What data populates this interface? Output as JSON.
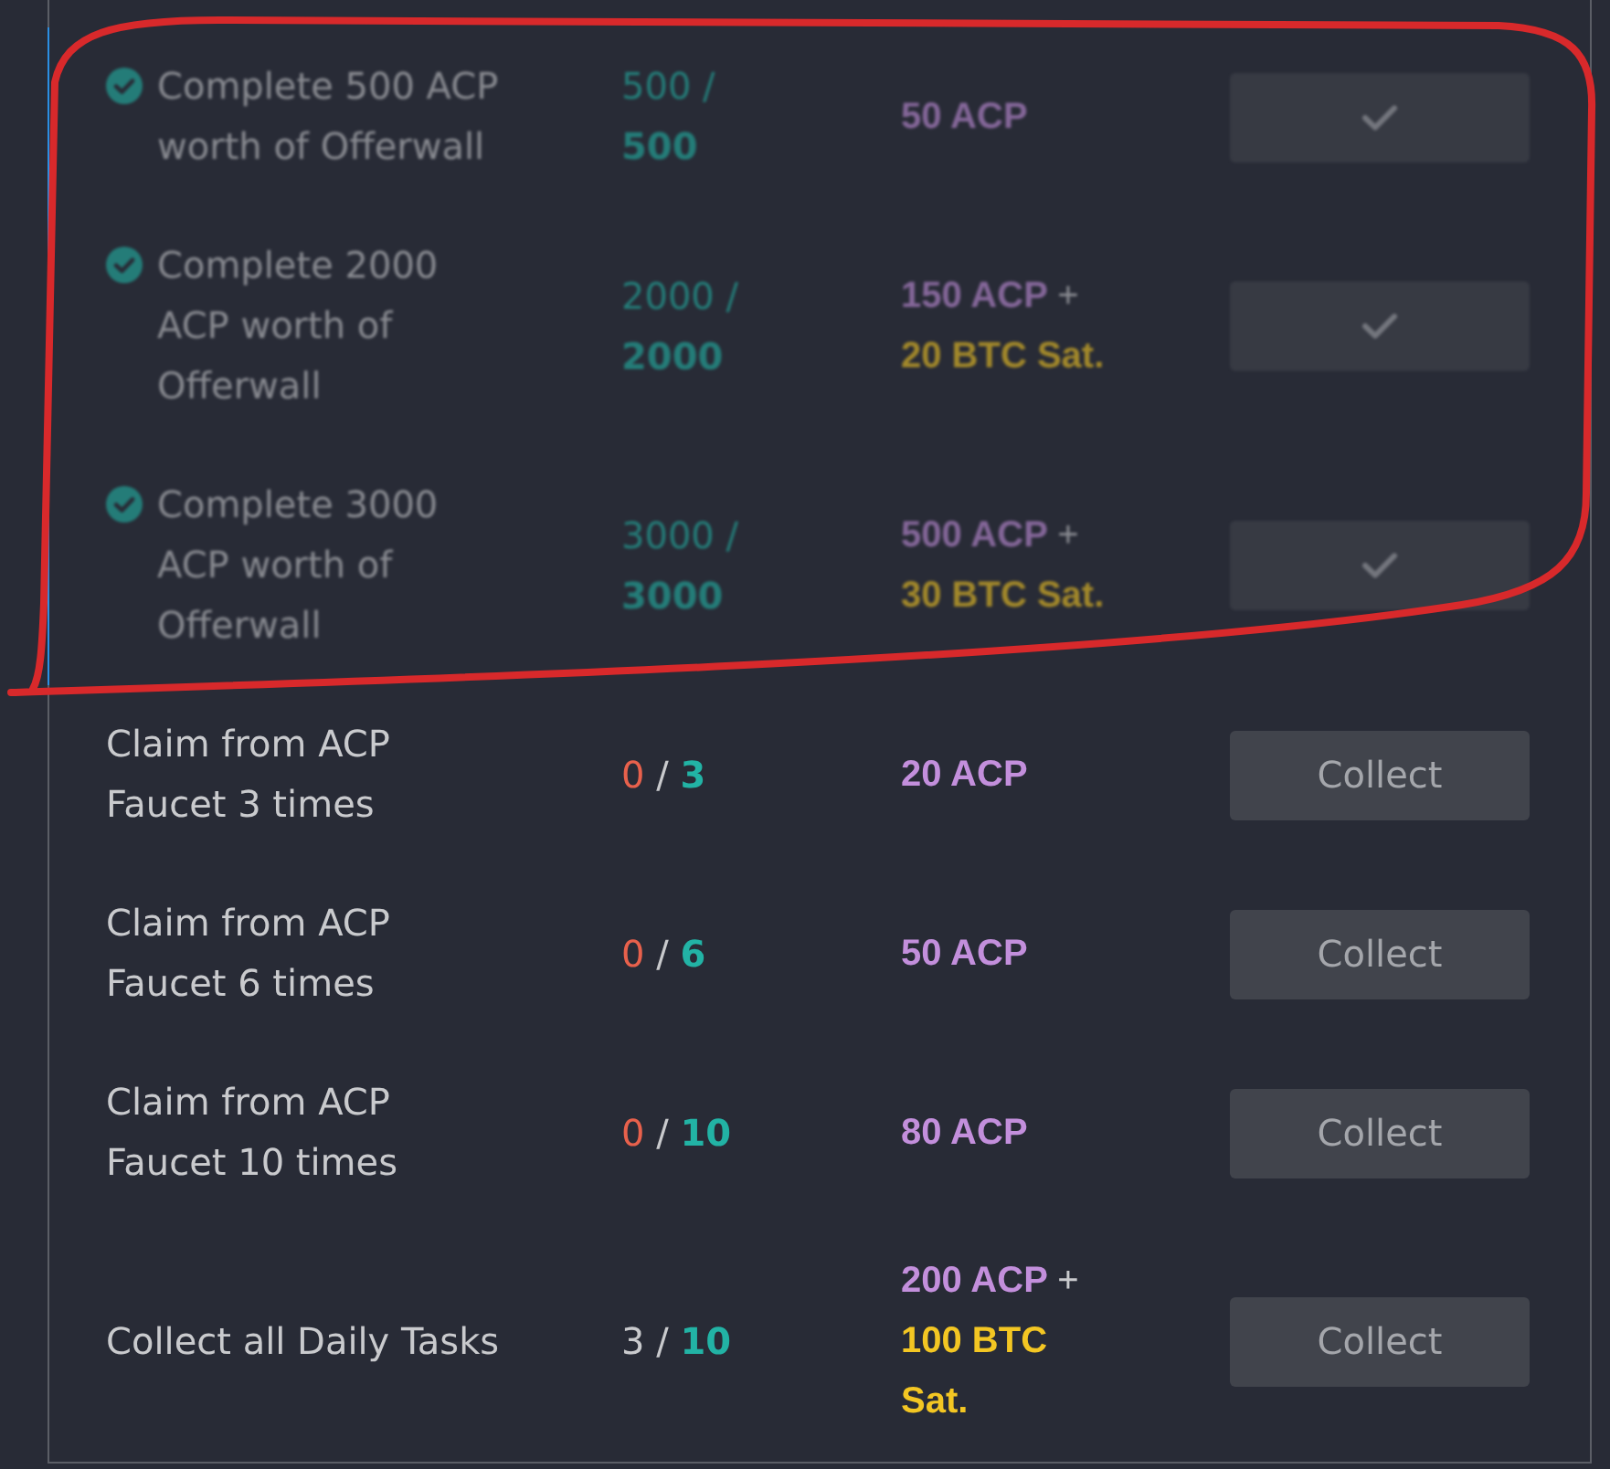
{
  "tasks": [
    {
      "completed": true,
      "name": "Complete 500 ACP worth of Offerwall",
      "progress": {
        "current": "500",
        "separator": "/",
        "total": "500"
      },
      "reward": [
        {
          "kind": "acp",
          "text": "50 ACP"
        }
      ]
    },
    {
      "completed": true,
      "name": "Complete 2000 ACP worth of Offerwall",
      "progress": {
        "current": "2000",
        "separator": "/",
        "total": "2000"
      },
      "reward": [
        {
          "kind": "acp",
          "text": "150 ACP"
        },
        {
          "kind": "plus",
          "text": "+"
        },
        {
          "kind": "btc",
          "text": "20 BTC Sat."
        }
      ]
    },
    {
      "completed": true,
      "name": "Complete 3000 ACP worth of Offerwall",
      "progress": {
        "current": "3000",
        "separator": "/",
        "total": "3000"
      },
      "reward": [
        {
          "kind": "acp",
          "text": "500 ACP"
        },
        {
          "kind": "plus",
          "text": "+"
        },
        {
          "kind": "btc",
          "text": "30 BTC Sat."
        }
      ]
    },
    {
      "completed": false,
      "name": "Claim from ACP Faucet 3 times",
      "progress": {
        "current": "0",
        "separator": "/",
        "total": "3",
        "started": false
      },
      "reward": [
        {
          "kind": "acp",
          "text": "20 ACP"
        }
      ],
      "button": "Collect"
    },
    {
      "completed": false,
      "name": "Claim from ACP Faucet 6 times",
      "progress": {
        "current": "0",
        "separator": "/",
        "total": "6",
        "started": false
      },
      "reward": [
        {
          "kind": "acp",
          "text": "50 ACP"
        }
      ],
      "button": "Collect"
    },
    {
      "completed": false,
      "name": "Claim from ACP Faucet 10 times",
      "progress": {
        "current": "0",
        "separator": "/",
        "total": "10",
        "started": false
      },
      "reward": [
        {
          "kind": "acp",
          "text": "80 ACP"
        }
      ],
      "button": "Collect"
    },
    {
      "completed": false,
      "name": "Collect all Daily Tasks",
      "progress": {
        "current": "3",
        "separator": "/",
        "total": "10",
        "started": true
      },
      "reward": [
        {
          "kind": "acp",
          "text": "200 ACP"
        },
        {
          "kind": "plus",
          "text": "+"
        },
        {
          "kind": "btc",
          "text": "100 BTC Sat."
        }
      ],
      "button": "Collect"
    }
  ],
  "annotations": [
    {
      "kind": "hand_drawn_loop"
    }
  ]
}
